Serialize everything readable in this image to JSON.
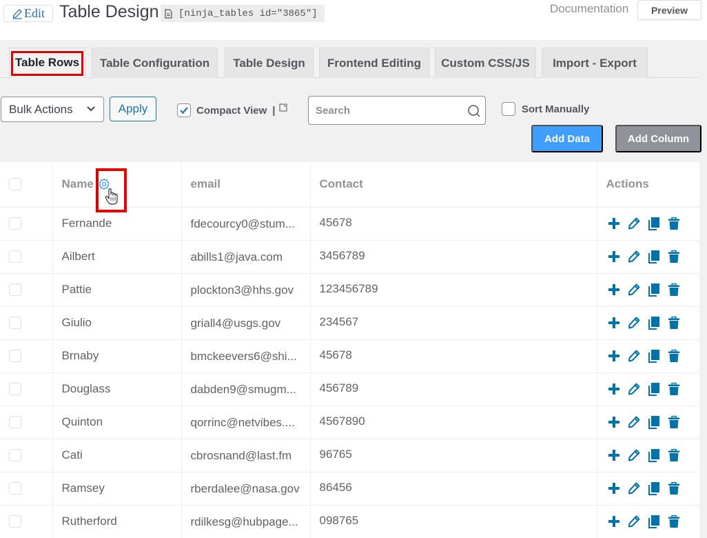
{
  "header": {
    "edit_label": "Edit",
    "title": "Table Design",
    "shortcode": "[ninja_tables id=\"3865\"]",
    "documentation_label": "Documentation",
    "preview_label": "Preview"
  },
  "tabs": [
    {
      "label": "Table Rows",
      "active": true
    },
    {
      "label": "Table Configuration",
      "active": false
    },
    {
      "label": "Table Design",
      "active": false
    },
    {
      "label": "Frontend Editing",
      "active": false
    },
    {
      "label": "Custom CSS/JS",
      "active": false
    },
    {
      "label": "Import - Export",
      "active": false
    }
  ],
  "toolbar": {
    "bulk_actions_label": "Bulk Actions",
    "apply_label": "Apply",
    "compact_view_label": "Compact View",
    "compact_view_checked": true,
    "compact_sep": "|",
    "search_placeholder": "Search",
    "search_value": "",
    "sort_manually_label": "Sort Manually",
    "sort_manually_checked": false,
    "add_data_label": "Add Data",
    "add_column_label": "Add Column"
  },
  "table": {
    "columns": [
      "Name",
      "email",
      "Contact",
      "Actions"
    ],
    "rows": [
      {
        "name": "Fernande",
        "email": "fdecourcy0@stum...",
        "contact": "45678"
      },
      {
        "name": "Ailbert",
        "email": "abills1@java.com",
        "contact": "3456789"
      },
      {
        "name": "Pattie",
        "email": "plockton3@hhs.gov",
        "contact": "123456789"
      },
      {
        "name": "Giulio",
        "email": "griall4@usgs.gov",
        "contact": "234567"
      },
      {
        "name": "Brnaby",
        "email": "bmckeevers6@shi...",
        "contact": "45678"
      },
      {
        "name": "Douglass",
        "email": "dabden9@smugm...",
        "contact": "456789"
      },
      {
        "name": "Quinton",
        "email": "qorrinc@netvibes....",
        "contact": "4567890"
      },
      {
        "name": "Cati",
        "email": "cbrosnand@last.fm",
        "contact": "96765"
      },
      {
        "name": "Ramsey",
        "email": "rberdalee@nasa.gov",
        "contact": "86456"
      },
      {
        "name": "Rutherford",
        "email": "rdilkesg@hubpage...",
        "contact": "098765"
      }
    ],
    "row_actions": [
      "add-icon",
      "edit-icon",
      "duplicate-icon",
      "delete-icon"
    ]
  },
  "colors": {
    "accent": "#2271b1",
    "primary_button": "#409eff",
    "secondary_button": "#909399",
    "action_icon": "#0073aa",
    "highlight": "#e00000"
  }
}
